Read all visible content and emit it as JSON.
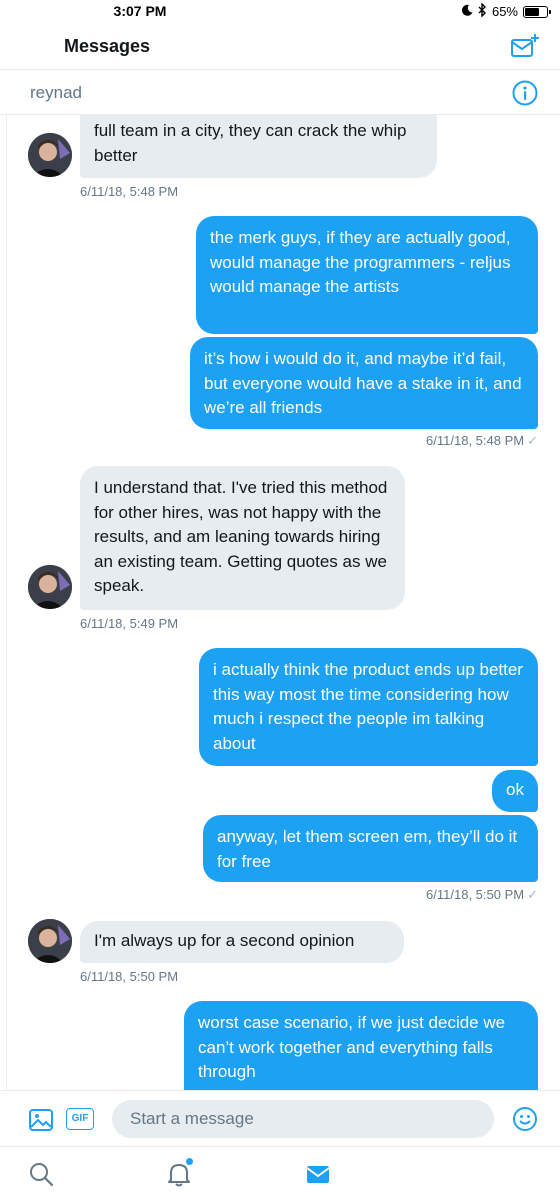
{
  "status_bar": {
    "time": "3:07 PM",
    "battery": "65%",
    "battery_level": 0.65
  },
  "header": {
    "title": "Messages",
    "compose_icon": "compose-message-icon"
  },
  "conversation": {
    "name": "reynad",
    "info_icon": "info-icon"
  },
  "messages": [
    {
      "dir": "in",
      "text": "full team in a city, they can crack the whip better"
    },
    {
      "dir": "in_time",
      "text": "6/11/18, 5:48 PM"
    },
    {
      "dir": "out",
      "text": "the merk guys, if they are actually good, would manage the programmers - reljus would manage the artists"
    },
    {
      "dir": "out",
      "text": "it’s how i would do it, and maybe it’d fail, but everyone would have a stake in it, and we’re all friends"
    },
    {
      "dir": "out_time",
      "text": "6/11/18, 5:48 PM"
    },
    {
      "dir": "in",
      "text": "I understand that. I've tried this method for other hires, was not happy with the results, and am leaning towards hiring an existing team. Getting quotes as we speak."
    },
    {
      "dir": "in_time",
      "text": "6/11/18, 5:49 PM"
    },
    {
      "dir": "out",
      "text": "i actually think the product ends up better this way most the time considering how much i respect the people im talking about"
    },
    {
      "dir": "out",
      "text": "ok"
    },
    {
      "dir": "out",
      "text": "anyway, let them screen em, they’ll do it for free"
    },
    {
      "dir": "out_time",
      "text": "6/11/18, 5:50 PM"
    },
    {
      "dir": "in",
      "text": "I'm always up for a second opinion"
    },
    {
      "dir": "in_time",
      "text": "6/11/18, 5:50 PM"
    },
    {
      "dir": "out",
      "text": "worst case scenario, if we just decide we can’t work together and everything falls through"
    }
  ],
  "composer": {
    "placeholder": "Start a message",
    "gif_label": "GIF"
  },
  "tabbar": {
    "tabs": [
      "search",
      "notifications",
      "messages"
    ],
    "active": "messages"
  },
  "colors": {
    "accent": "#1da1f2",
    "incoming_bubble": "#e6ecf0",
    "muted_text": "#657786"
  }
}
